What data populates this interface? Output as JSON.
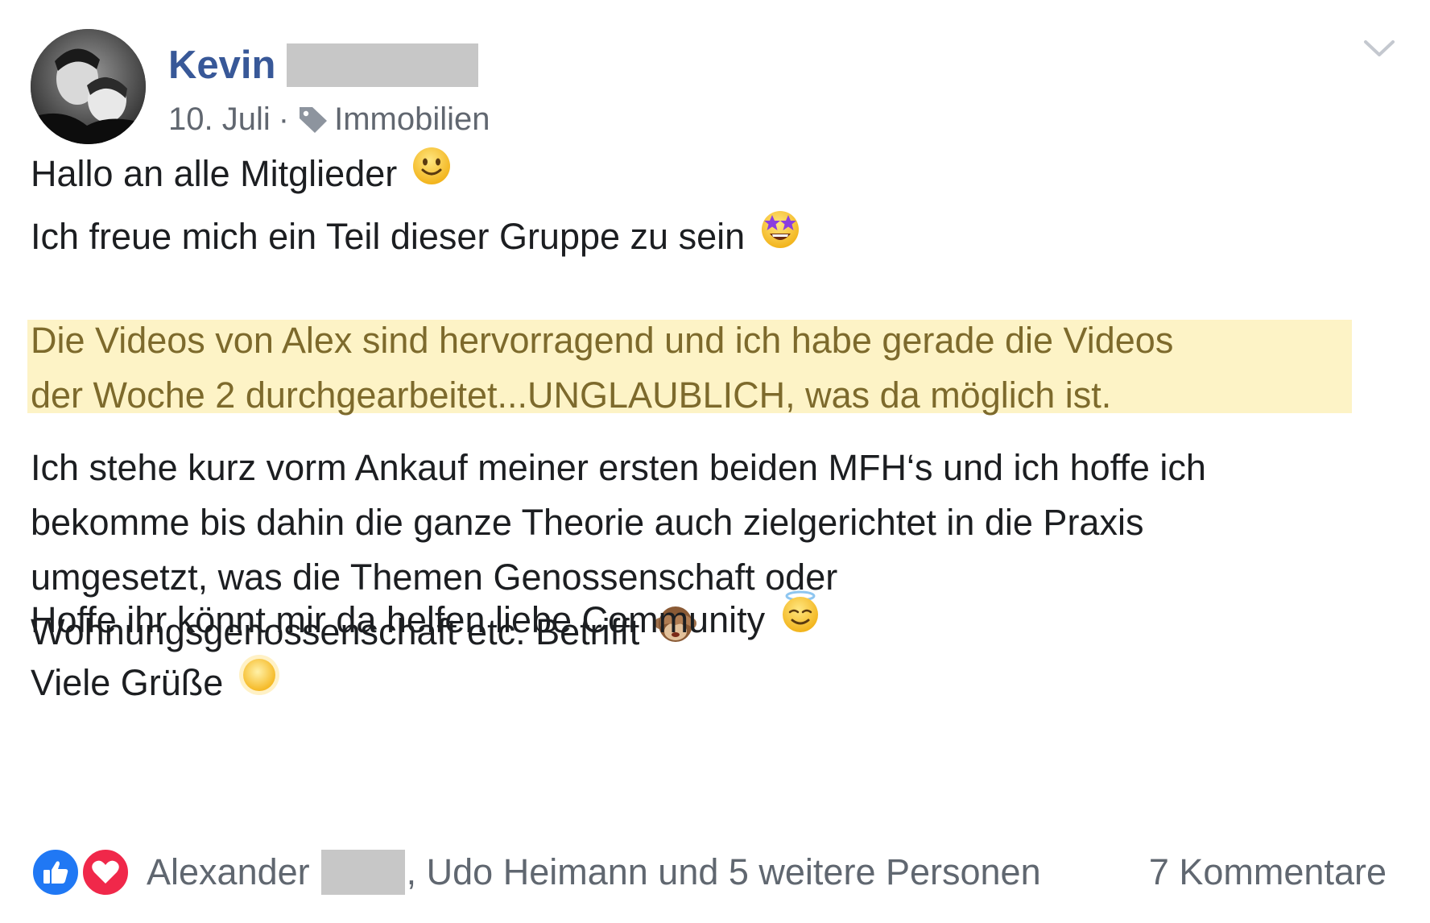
{
  "post": {
    "author_first_name": "Kevin",
    "date": "10. Juli",
    "separator": "·",
    "topic": "Immobilien",
    "paragraphs": {
      "p1": "Hallo an alle Mitglieder",
      "p2": "Ich freue mich ein Teil dieser Gruppe zu sein",
      "p3_line1": "Die Videos von Alex sind hervorragend und ich habe gerade die Videos",
      "p3_line2": "der Woche 2 durchgearbeitet...UNGLAUBLICH, was da möglich ist.",
      "p4_line1": "Ich stehe kurz vorm Ankauf meiner ersten beiden MFH‘s und ich hoffe ich",
      "p4_line2": "bekomme bis dahin die ganze Theorie auch zielgerichtet in die Praxis",
      "p4_line3": "umgesetzt, was die Themen Genossenschaft oder",
      "p4_line4": "Wohnungsgenossenschaft etc. Betrifft",
      "p5": "Hoffe ihr könnt mir da helfen liebe Community",
      "p6": "Viele Grüße"
    },
    "emojis": [
      "slightly-smiling-face",
      "star-struck",
      "see-no-evil-monkey",
      "smiling-face-with-halo",
      "sun"
    ]
  },
  "footer": {
    "reactions": [
      "like",
      "love"
    ],
    "liker_first": "Alexander",
    "liker_rest": ", Udo Heimann und 5 weitere Personen",
    "comments": "7 Kommentare"
  },
  "colors": {
    "author_blue": "#385898",
    "meta_gray": "#616770",
    "highlight_bg": "#fdf3c6",
    "highlight_text": "#7d6a2c",
    "like_blue": "#2078f4",
    "love_red": "#f0284a",
    "redaction_gray": "#c7c7c7"
  }
}
